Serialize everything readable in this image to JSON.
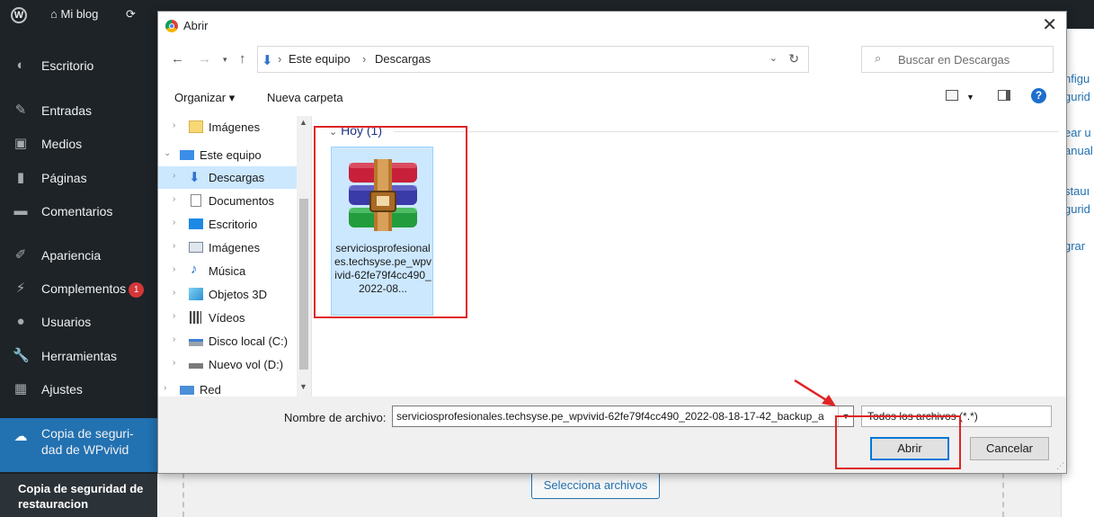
{
  "adminbar": {
    "site_name": "Mi blog"
  },
  "sidebar": {
    "items": [
      {
        "label": "Escritorio",
        "icon": "dashboard-icon"
      },
      {
        "label": "Entradas",
        "icon": "pin-icon"
      },
      {
        "label": "Medios",
        "icon": "media-icon"
      },
      {
        "label": "Páginas",
        "icon": "pages-icon"
      },
      {
        "label": "Comentarios",
        "icon": "comments-icon"
      },
      {
        "label": "Apariencia",
        "icon": "appearance-icon"
      },
      {
        "label": "Complementos",
        "icon": "plugins-icon",
        "badge": "1"
      },
      {
        "label": "Usuarios",
        "icon": "users-icon"
      },
      {
        "label": "Herramientas",
        "icon": "tools-icon"
      },
      {
        "label": "Ajustes",
        "icon": "settings-icon"
      },
      {
        "label": "Copia de seguri-dad de WPvivid",
        "icon": "cloud-icon"
      }
    ],
    "submenu_label": "Copia de seguridad de restauracion"
  },
  "page_right": {
    "fragments": [
      "nfigu",
      "gurid",
      "ear u",
      "anual",
      "stauı",
      "gurid",
      "grar"
    ]
  },
  "page": {
    "select_files_label": "Selecciona archivos"
  },
  "dialog": {
    "title": "Abrir",
    "breadcrumb": [
      "Este equipo",
      "Descargas"
    ],
    "search_placeholder": "Buscar en Descargas",
    "organize_label": "Organizar ▾",
    "new_folder_label": "Nueva carpeta",
    "nav_items": [
      {
        "label": "Imágenes",
        "icon": "folder-icon",
        "indent": 1
      },
      {
        "label": "Este equipo",
        "icon": "computer-icon",
        "indent": 0
      },
      {
        "label": "Descargas",
        "icon": "download-icon",
        "indent": 1,
        "selected": true
      },
      {
        "label": "Documentos",
        "icon": "documents-icon",
        "indent": 1
      },
      {
        "label": "Escritorio",
        "icon": "desktop-icon",
        "indent": 1
      },
      {
        "label": "Imágenes",
        "icon": "pictures-icon",
        "indent": 1
      },
      {
        "label": "Música",
        "icon": "music-icon",
        "indent": 1
      },
      {
        "label": "Objetos 3D",
        "icon": "objects3d-icon",
        "indent": 1
      },
      {
        "label": "Vídeos",
        "icon": "videos-icon",
        "indent": 1
      },
      {
        "label": "Disco local (C:)",
        "icon": "drive-c-icon",
        "indent": 1
      },
      {
        "label": "Nuevo vol (D:)",
        "icon": "drive-d-icon",
        "indent": 1
      },
      {
        "label": "Red",
        "icon": "network-icon",
        "indent": 0
      }
    ],
    "group_header": "Hoy (1)",
    "file": {
      "name": "serviciosprofesionales.techsyse.pe_wpvivid-62fe79f4cc490_2022-08...",
      "icon": "winrar-archive-icon"
    },
    "filename_label": "Nombre de archivo:",
    "filename_value": "serviciosprofesionales.techsyse.pe_wpvivid-62fe79f4cc490_2022-08-18-17-42_backup_a",
    "filetype_value": "Todos los archivos (*.*)",
    "open_label": "Abrir",
    "cancel_label": "Cancelar"
  },
  "colors": {
    "wp_dark": "#1d2327",
    "wp_blue": "#2271b1",
    "selection": "#cce8ff",
    "annotation_red": "#e02424"
  }
}
